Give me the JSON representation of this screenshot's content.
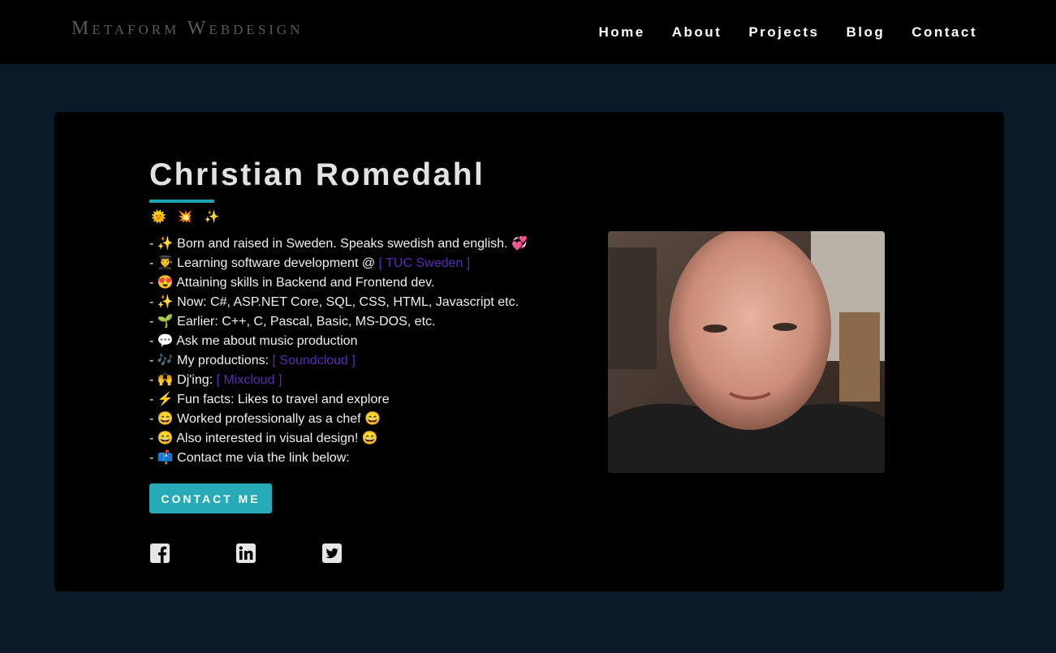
{
  "header": {
    "brand": "Metaform Webdesign",
    "nav": [
      "Home",
      "About",
      "Projects",
      "Blog",
      "Contact"
    ]
  },
  "profile": {
    "name": "Christian Romedahl",
    "emoji_row": "🌞 💥 ✨",
    "facts": [
      {
        "prefix": "- ✨ Born and raised in Sweden. Speaks swedish and english. 💞",
        "link": ""
      },
      {
        "prefix": "- 👨‍🎓 Learning software development @ ",
        "link": "[ TUC Sweden ]"
      },
      {
        "prefix": "- 😍 Attaining skills in Backend and Frontend dev.",
        "link": ""
      },
      {
        "prefix": "- ✨ Now: C#, ASP.NET Core, SQL, CSS, HTML, Javascript etc.",
        "link": ""
      },
      {
        "prefix": "- 🌱 Earlier: C++, C, Pascal, Basic, MS-DOS, etc.",
        "link": ""
      },
      {
        "prefix": "- 💬 Ask me about music production",
        "link": ""
      },
      {
        "prefix": "- 🎶 My productions: ",
        "link": "[ Soundcloud ]"
      },
      {
        "prefix": "- 🙌 Dj'ing: ",
        "link": "[ Mixcloud ]"
      },
      {
        "prefix": "- ⚡ Fun facts: Likes to travel and explore",
        "link": ""
      },
      {
        "prefix": "- 😄 Worked professionally as a chef 😄",
        "link": ""
      },
      {
        "prefix": "- 😄 Also interested in visual design! 😄",
        "link": ""
      },
      {
        "prefix": "- 📫 Contact me via the link below:",
        "link": ""
      }
    ],
    "contact_button": "CONTACT ME",
    "social_icons": [
      "facebook-icon",
      "linkedin-icon",
      "twitter-icon"
    ]
  },
  "colors": {
    "page_bg": "#0a1a28",
    "accent": "#26aab8",
    "link": "#5b2bb5"
  }
}
